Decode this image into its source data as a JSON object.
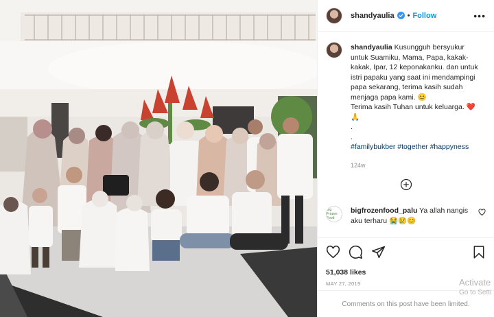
{
  "post": {
    "author": "shandyaulia",
    "follow_label": "Follow",
    "more_label": "•••",
    "caption_lines": [
      "Kusungguh bersyukur",
      "untuk Suamiku, Mama, Papa, kakak-",
      "kakak, Ipar, 12 keponakanku. dan untuk",
      "istri papaku yang saat ini mendampingi",
      "papa sekarang, terima kasih sudah",
      "menjaga papa kami. 😊",
      "Terima kasih Tuhan untuk keluarga. ❤️",
      "🙏",
      ".",
      "."
    ],
    "hashtags": "#familybukber #together #happyness",
    "caption_time": "124w",
    "likes": "51,038 likes",
    "date": "MAY 27, 2019",
    "comments_limited": "Comments on this post have been limited."
  },
  "comment": {
    "username": "bigfrozenfood_palu",
    "text": "Ya allah nangis aku terharu 😭😢😊",
    "avatar_text": "Big Frozen Food"
  },
  "overlay": {
    "activate_title": "Activate",
    "activate_sub": "Go to Setti"
  },
  "colors": {
    "link": "#0095f6",
    "hashtag": "#00376b",
    "muted": "#8e8e8e",
    "verified": "#3897f0"
  },
  "icons": [
    "verified-badge-icon",
    "more-icon",
    "add-circle-icon",
    "heart-icon",
    "comment-icon",
    "share-icon",
    "bookmark-icon"
  ]
}
